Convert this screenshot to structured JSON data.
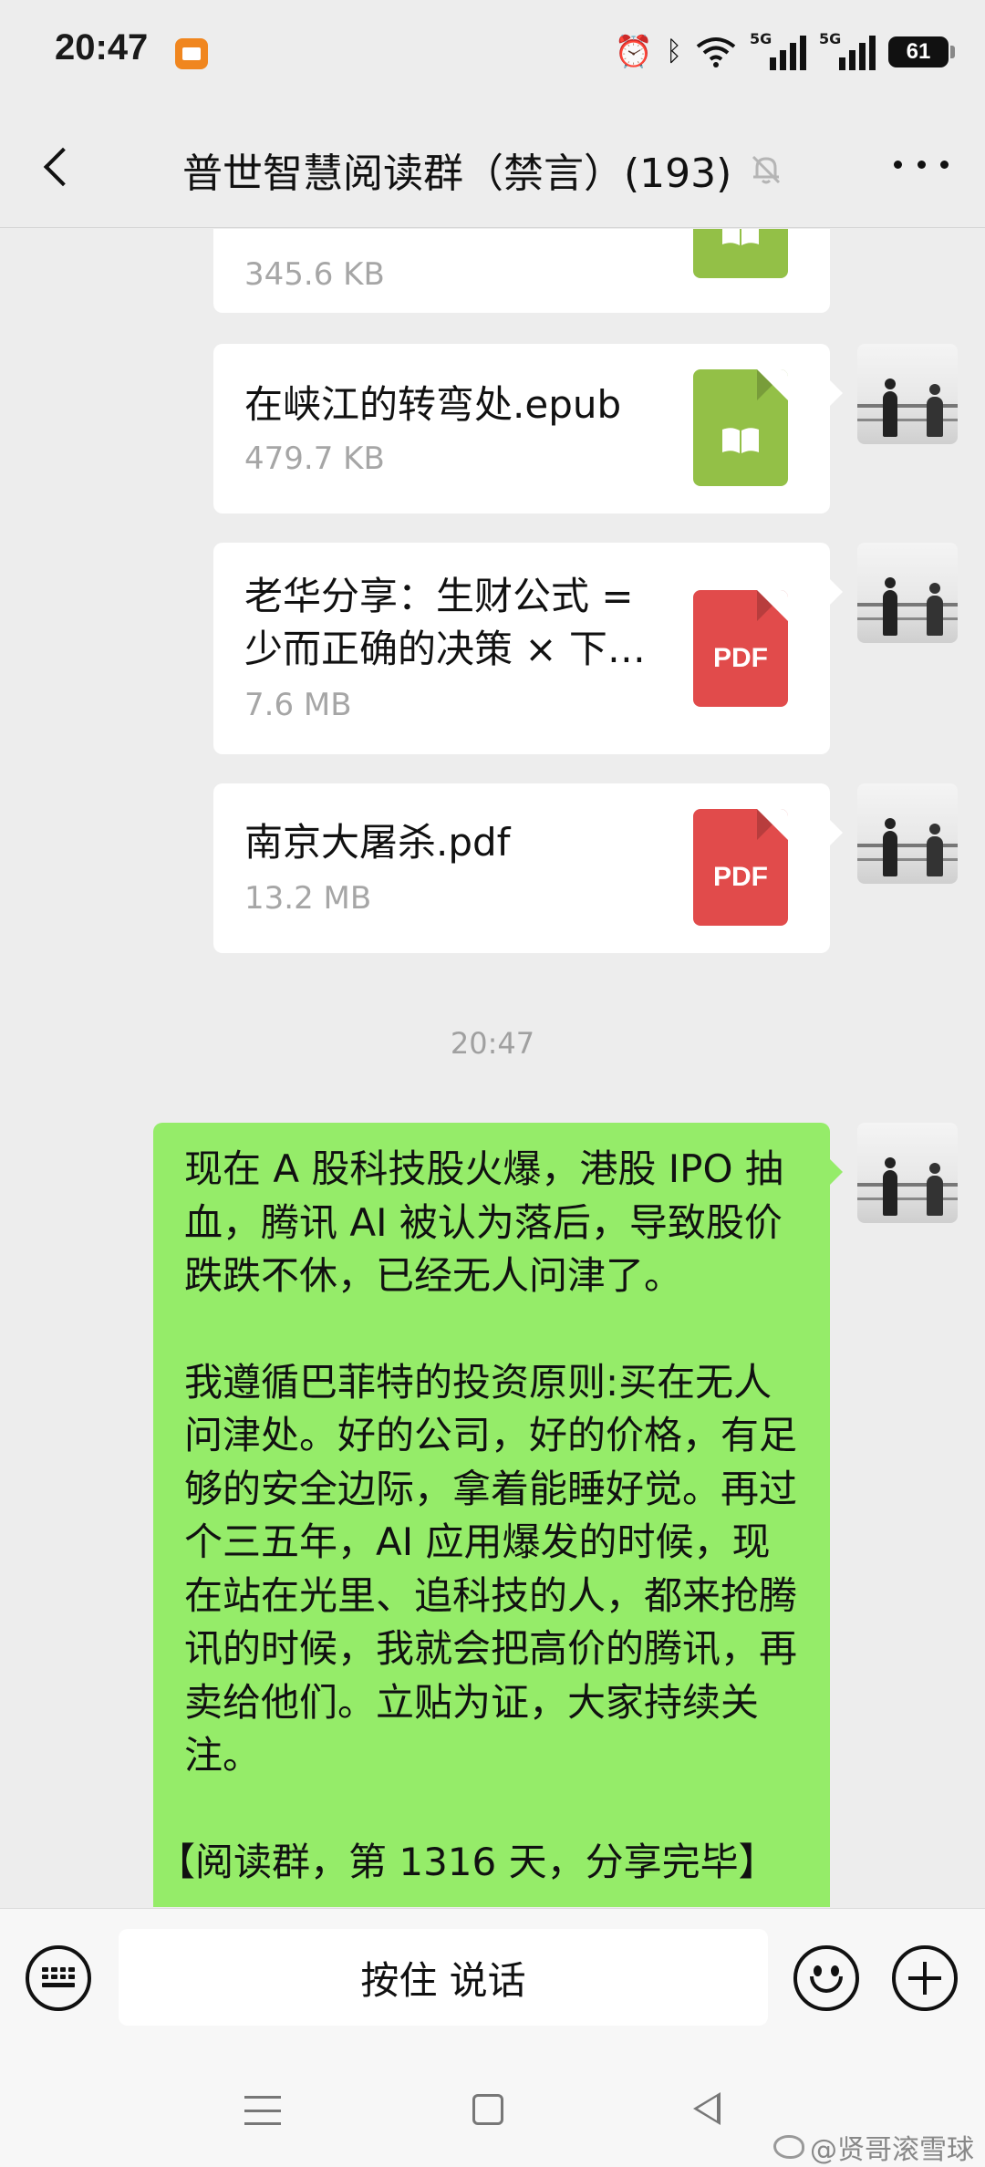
{
  "status_bar": {
    "time": "20:47",
    "network_1": "5G",
    "network_2": "5G",
    "battery": "61"
  },
  "header": {
    "title": "普世智慧阅读群（禁言）(193)",
    "muted": true
  },
  "files": [
    {
      "name": "",
      "size": "345.6 KB",
      "type": "epub"
    },
    {
      "name": "在峡江的转弯处.epub",
      "size": "479.7 KB",
      "type": "epub"
    },
    {
      "name": "老华分享：生财公式 = 少而正确的决策 × 下…",
      "size": "7.6 MB",
      "type": "pdf"
    },
    {
      "name": "南京大屠杀.pdf",
      "size": "13.2 MB",
      "type": "pdf"
    }
  ],
  "pdf_label": "PDF",
  "timestamp": "20:47",
  "message": {
    "paragraphs": [
      "现在 A 股科技股火爆，港股 IPO 抽血，腾讯 AI 被认为落后，导致股价跌跌不休，已经无人问津了。",
      "我遵循巴菲特的投资原则:买在无人问津处。好的公司，好的价格，有足够的安全边际，拿着能睡好觉。再过个三五年，AI 应用爆发的时候，现在站在光里、追科技的人，都来抢腾讯的时候，我就会把高价的腾讯，再卖给他们。立贴为证，大家持续关注。",
      "【阅读群，第 1316 天，分享完毕】"
    ]
  },
  "input_bar": {
    "voice_label": "按住 说话"
  },
  "watermark": "@贤哥滚雪球",
  "colors": {
    "bubble_green": "#95ec69",
    "epub_green": "#93c047",
    "pdf_red": "#e14b4b",
    "background": "#ededed"
  }
}
